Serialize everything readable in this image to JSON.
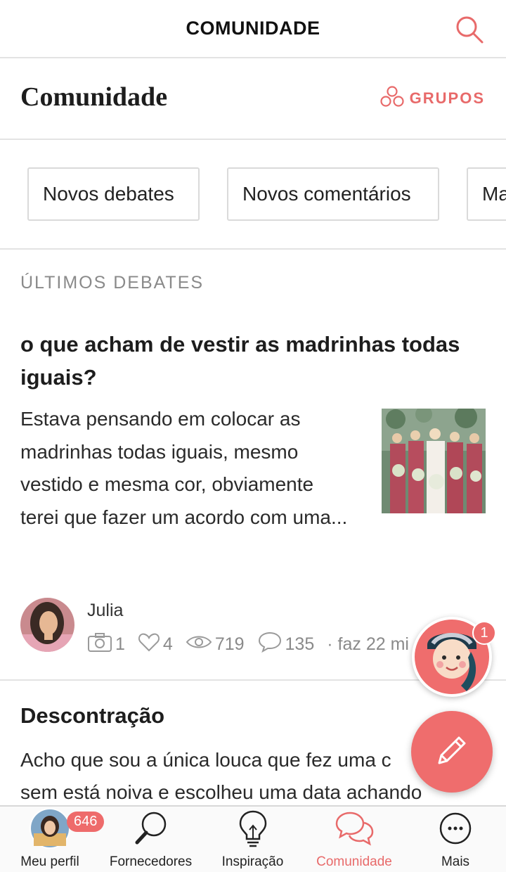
{
  "topbar": {
    "title": "COMUNIDADE",
    "search_icon": "search-icon"
  },
  "header": {
    "title": "Comunidade",
    "groups_label": "GRUPOS",
    "groups_icon": "groups-icon"
  },
  "chips": [
    "Novos debates",
    "Novos comentários",
    "Ma"
  ],
  "section_label": "ÚLTIMOS DEBATES",
  "post": {
    "title": "o que acham de vestir as madrinhas todas iguais?",
    "excerpt": "Estava pensando em colocar as madrinhas todas iguais, mesmo vestido e mesma cor, obviamente terei que fazer um acordo com uma...",
    "author": "Julia",
    "photos": "1",
    "likes": "4",
    "views": "719",
    "comments": "135",
    "time": "· faz 22 mi"
  },
  "post2": {
    "title": "Descontração",
    "line1": "Acho que sou a única louca que fez uma c",
    "line2": "sem está noiva e escolheu uma data achando"
  },
  "assistant": {
    "badge": "1"
  },
  "tabbar": {
    "items": [
      {
        "label": "Meu perfil",
        "icon": "profile-avatar",
        "count": "646"
      },
      {
        "label": "Fornecedores",
        "icon": "magnifier-icon"
      },
      {
        "label": "Inspiração",
        "icon": "lightbulb-icon"
      },
      {
        "label": "Comunidade",
        "icon": "chat-bubbles-icon"
      },
      {
        "label": "Mais",
        "icon": "more-icon"
      }
    ],
    "active": "Comunidade"
  },
  "colors": {
    "accent": "#ef6d6d",
    "divider": "#e3e3e3",
    "muted": "#8a8a8a"
  }
}
